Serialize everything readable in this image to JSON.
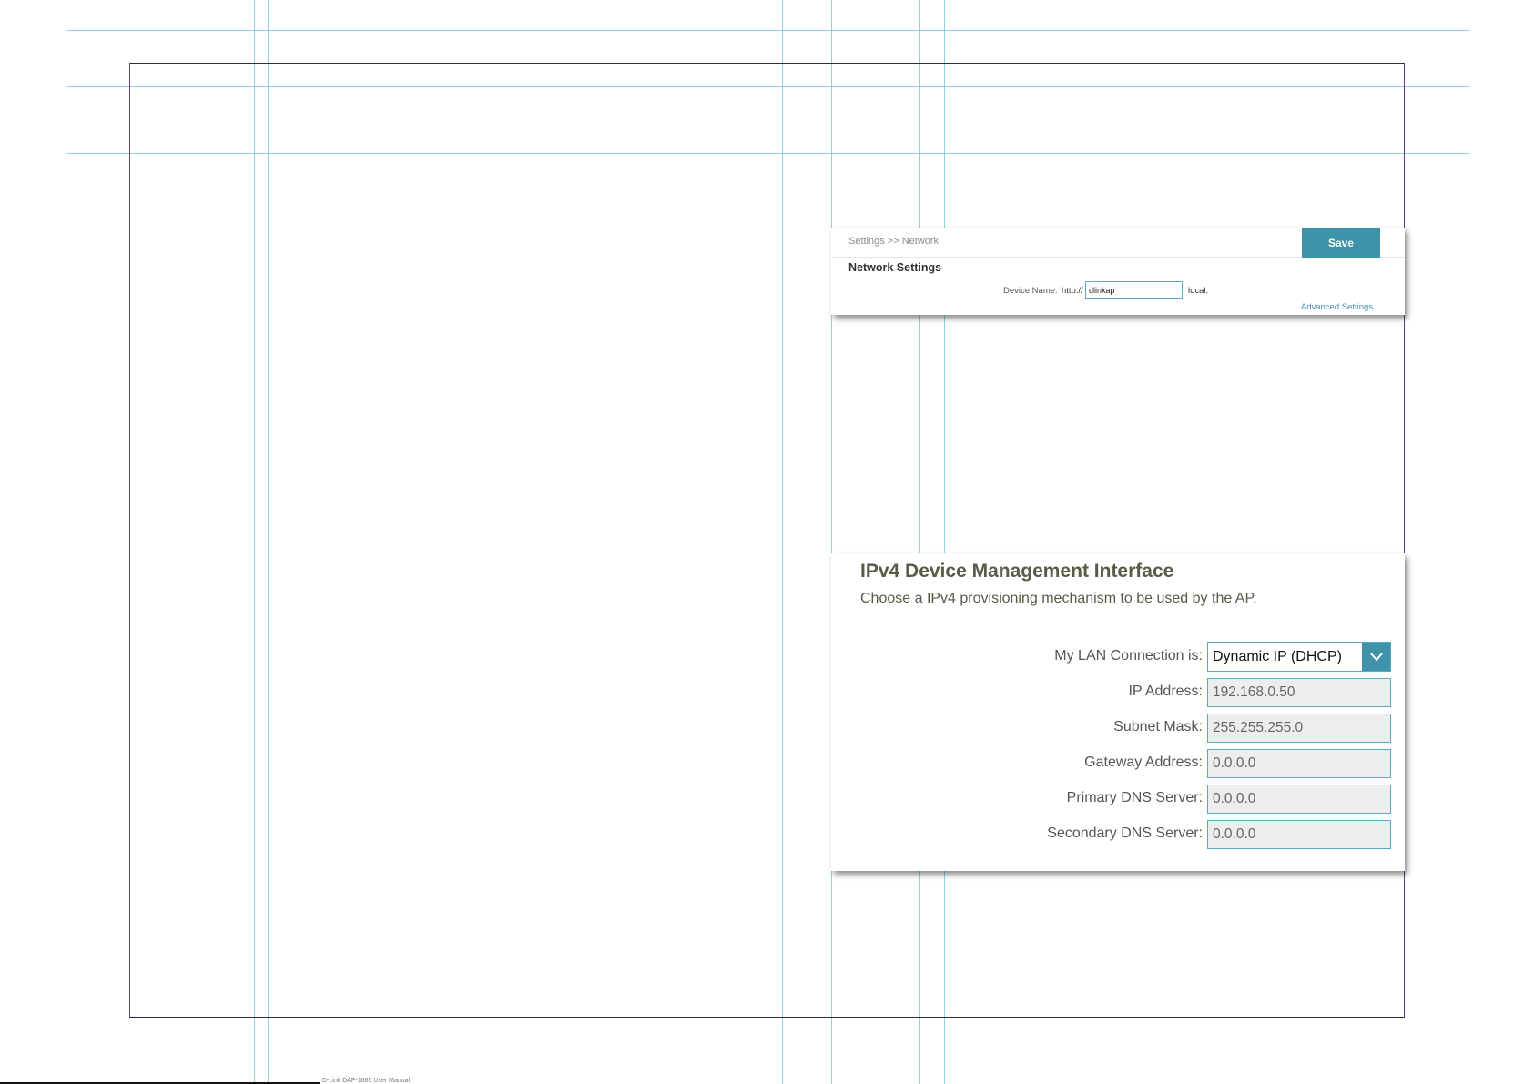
{
  "network_panel": {
    "breadcrumb": "Settings >> Network",
    "save_label": "Save",
    "heading": "Network Settings",
    "device_name_label": "Device Name:",
    "url_prefix": "http://",
    "device_name_value": "dlinkap",
    "url_suffix": "local.",
    "advanced_link": "Advanced Settings..."
  },
  "ipv4_panel": {
    "title": "IPv4 Device Management Interface",
    "subtitle": "Choose a IPv4 provisioning mechanism to be used by the AP.",
    "rows": [
      {
        "label": "My LAN Connection is:",
        "value": "Dynamic IP (DHCP)"
      },
      {
        "label": "IP Address:",
        "value": "192.168.0.50"
      },
      {
        "label": "Subnet Mask:",
        "value": "255.255.255.0"
      },
      {
        "label": "Gateway Address:",
        "value": "0.0.0.0"
      },
      {
        "label": "Primary DNS Server:",
        "value": "0.0.0.0"
      },
      {
        "label": "Secondary DNS Server:",
        "value": "0.0.0.0"
      }
    ]
  },
  "icons": {
    "dropdown": "chevron-down-icon"
  },
  "colors": {
    "accent": "#3f93a8",
    "guide": "#8fd3e2",
    "frame": "#5c3f8a"
  },
  "footer": {
    "text": "D-Link DAP-1665 User Manual"
  }
}
